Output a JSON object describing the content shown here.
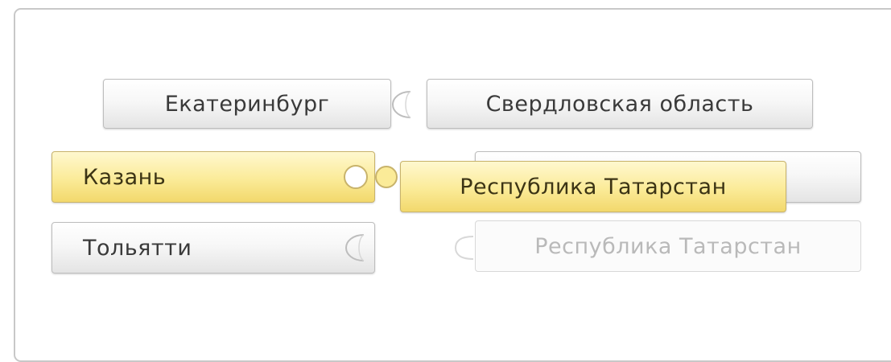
{
  "rows": {
    "row1": {
      "left_label": "Екатеринбург",
      "right_label": "Свердловская область"
    },
    "row2": {
      "left_label": "Казань",
      "right_label": "",
      "dragged_label": "Республика Татарстан"
    },
    "row3": {
      "left_label": "Тольятти",
      "right_label": "Республика Татарстан"
    }
  },
  "colors": {
    "selected_fill": "#fbeb98",
    "tile_fill": "#f2f2f2",
    "ghost_text": "#b9b9b9"
  }
}
